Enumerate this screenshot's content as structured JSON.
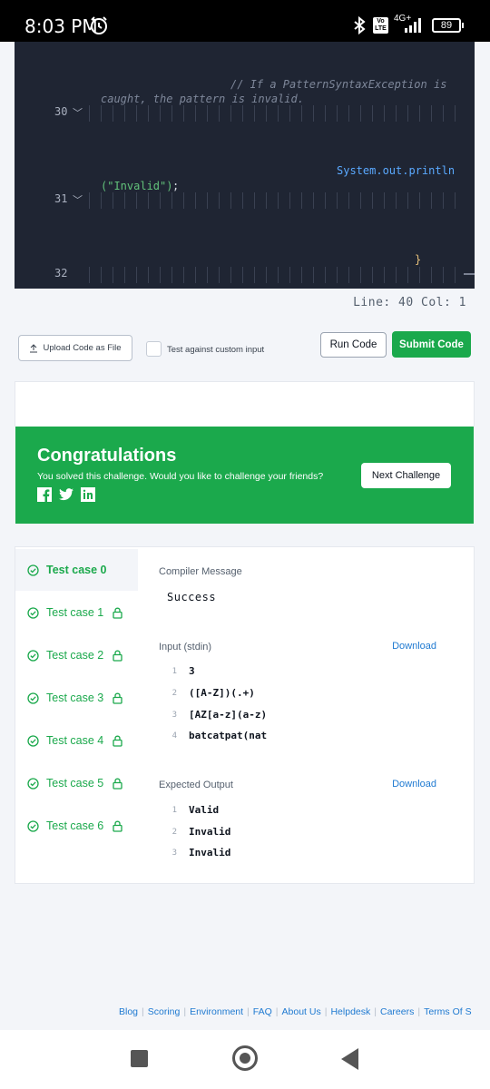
{
  "status_bar": {
    "time": "8:03 PM",
    "network": "4G+",
    "battery": "89"
  },
  "editor": {
    "lines": [
      {
        "num": "",
        "text_a": "// If a PatternSyntaxException is",
        "text_b": "caught, the pattern is invalid."
      },
      {
        "num": "30"
      },
      {
        "num": "",
        "code": "System.out.println",
        "code_str": "(\"Invalid\")",
        "code_end": ";"
      },
      {
        "num": "31"
      },
      {
        "num": "",
        "brace": "}"
      },
      {
        "num": "32"
      }
    ],
    "status": "Line: 40 Col: 1"
  },
  "actions": {
    "upload_label": "Upload Code as File",
    "custom_input_label": "Test against custom input",
    "run_label": "Run Code",
    "submit_label": "Submit Code"
  },
  "congrats": {
    "title": "Congratulations",
    "subtitle": "You solved this challenge. Would you like to challenge your friends?",
    "next_label": "Next Challenge"
  },
  "test_cases": [
    {
      "label": "Test case 0"
    },
    {
      "label": "Test case 1"
    },
    {
      "label": "Test case 2"
    },
    {
      "label": "Test case 3"
    },
    {
      "label": "Test case 4"
    },
    {
      "label": "Test case 5"
    },
    {
      "label": "Test case 6"
    }
  ],
  "result": {
    "compiler_label": "Compiler Message",
    "compiler_message": "Success",
    "input_label": "Input (stdin)",
    "download_label": "Download",
    "input_lines": [
      {
        "n": "1",
        "v": "3"
      },
      {
        "n": "2",
        "v": "([A-Z])(.+)"
      },
      {
        "n": "3",
        "v": "[AZ[a-z](a-z)"
      },
      {
        "n": "4",
        "v": "batcatpat(nat"
      }
    ],
    "expected_label": "Expected Output",
    "expected_lines": [
      {
        "n": "1",
        "v": "Valid"
      },
      {
        "n": "2",
        "v": "Invalid"
      },
      {
        "n": "3",
        "v": "Invalid"
      }
    ]
  },
  "footer": {
    "links": [
      "Blog",
      "Scoring",
      "Environment",
      "FAQ",
      "About Us",
      "Helpdesk",
      "Careers",
      "Terms Of S"
    ]
  }
}
